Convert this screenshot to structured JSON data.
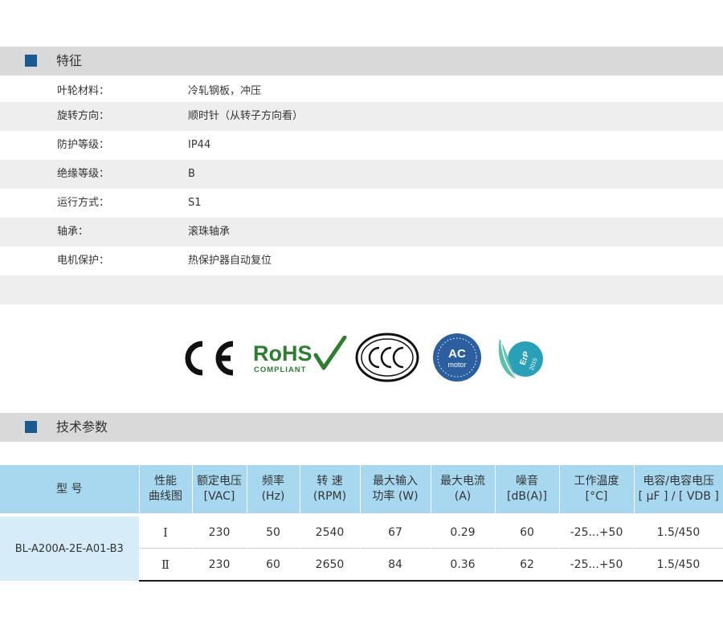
{
  "features_section": {
    "title": "特征"
  },
  "features": [
    {
      "label": "叶轮材料：",
      "value": "冷轧钢板，冲压"
    },
    {
      "label": "旋转方向：",
      "value": "顺时针（从转子方向看）"
    },
    {
      "label": "防护等级：",
      "value": "IP44"
    },
    {
      "label": "绝缘等级：",
      "value": "B"
    },
    {
      "label": "运行方式：",
      "value": "S1"
    },
    {
      "label": "轴承：",
      "value": "滚珠轴承"
    },
    {
      "label": "电机保护：",
      "value": "热保护器自动复位"
    }
  ],
  "badges": {
    "ce": "CE",
    "rohs": "RoHS",
    "rohs_sub": "COMPLIANT",
    "ccc": "CCC",
    "ac_line1": "AC",
    "ac_line2": "motor",
    "erp_line1": "ErP",
    "erp_line2": "2015"
  },
  "tech_section": {
    "title": "技术参数"
  },
  "table": {
    "headers": [
      {
        "l1": "型 号",
        "l2": ""
      },
      {
        "l1": "性能",
        "l2": "曲线图"
      },
      {
        "l1": "额定电压",
        "l2": "[VAC]"
      },
      {
        "l1": "频率",
        "l2": "(Hz)"
      },
      {
        "l1": "转 速",
        "l2": "(RPM)"
      },
      {
        "l1": "最大输入",
        "l2": "功率 (W)"
      },
      {
        "l1": "最大电流",
        "l2": "(A)"
      },
      {
        "l1": "噪音",
        "l2": "[dB(A)]"
      },
      {
        "l1": "工作温度",
        "l2": "[°C]"
      },
      {
        "l1": "电容/电容电压",
        "l2": "[ μF ] / [ VDB ]"
      }
    ],
    "model": "BL-A200A-2E-A01-B3",
    "rows": [
      {
        "curve": "Ⅰ",
        "voltage": "230",
        "freq": "50",
        "rpm": "2540",
        "power": "67",
        "current": "0.29",
        "noise": "60",
        "temp": "-25...+50",
        "cap": "1.5/450"
      },
      {
        "curve": "Ⅱ",
        "voltage": "230",
        "freq": "60",
        "rpm": "2650",
        "power": "84",
        "current": "0.36",
        "noise": "62",
        "temp": "-25...+50",
        "cap": "1.5/450"
      }
    ]
  }
}
